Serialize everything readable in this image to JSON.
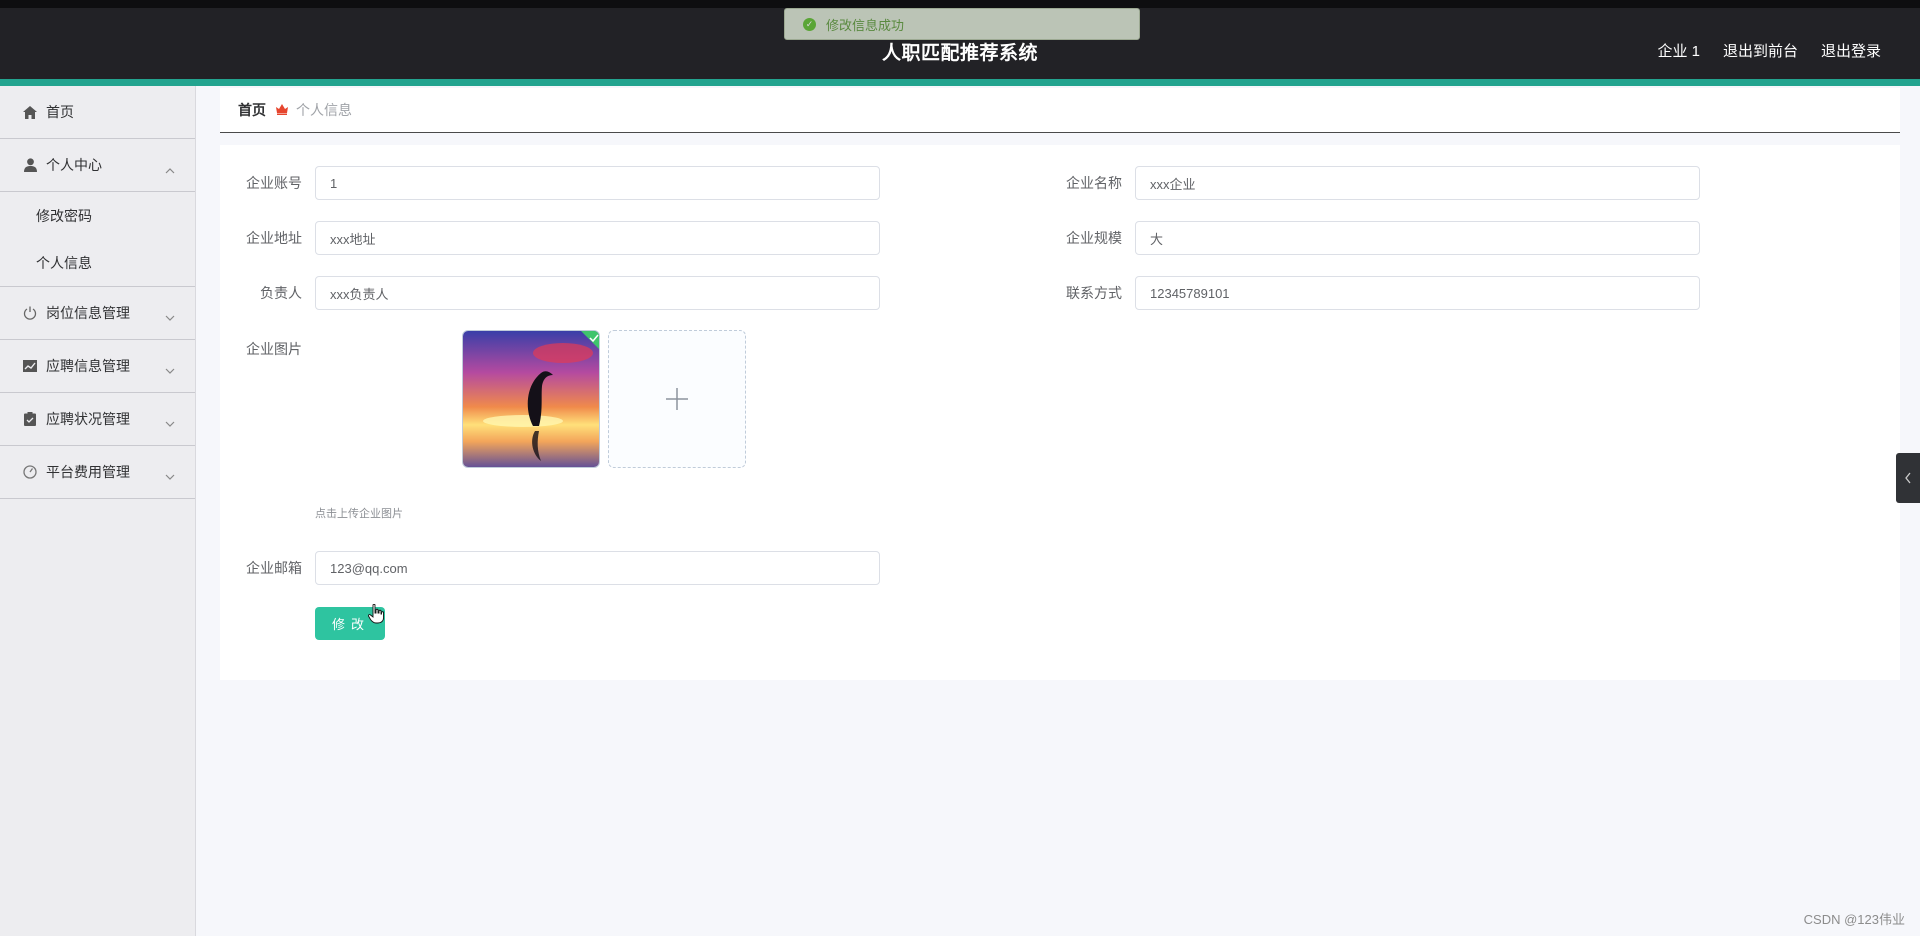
{
  "header": {
    "title": "人职匹配推荐系统",
    "nav": [
      "企业 1",
      "退出到前台",
      "退出登录"
    ]
  },
  "toast": {
    "message": "修改信息成功"
  },
  "sidebar": {
    "home": "首页",
    "personal_center": "个人中心",
    "change_password": "修改密码",
    "personal_info": "个人信息",
    "job_mgmt": "岗位信息管理",
    "application_mgmt": "应聘信息管理",
    "status_mgmt": "应聘状况管理",
    "fee_mgmt": "平台费用管理"
  },
  "breadcrumb": {
    "home": "首页",
    "current": "个人信息"
  },
  "form": {
    "account_label": "企业账号",
    "account_value": "1",
    "name_label": "企业名称",
    "name_value": "xxx企业",
    "address_label": "企业地址",
    "address_value": "xxx地址",
    "scale_label": "企业规模",
    "scale_value": "大",
    "contact_person_label": "负责人",
    "contact_person_value": "xxx负责人",
    "phone_label": "联系方式",
    "phone_value": "12345789101",
    "image_label": "企业图片",
    "upload_hint": "点击上传企业图片",
    "email_label": "企业邮箱",
    "email_value": "123@qq.com",
    "submit_label": "修改"
  },
  "watermark": "CSDN @123伟业",
  "colors": {
    "accent": "#2ec4a0",
    "header_bg": "#222226",
    "header_bar": "#23a48f"
  }
}
